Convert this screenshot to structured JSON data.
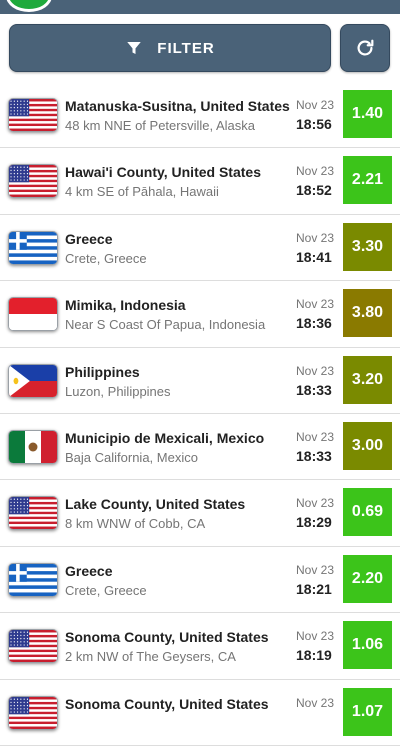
{
  "toolbar": {
    "filter_label": "FILTER",
    "filter_icon": "funnel-icon",
    "refresh_icon": "refresh-icon"
  },
  "colors": {
    "header": "#4a6278",
    "mag_low": "#3cc41a",
    "mag_mid": "#7a8a00",
    "mag_high": "#8a7a00"
  },
  "quakes": [
    {
      "place": "Matanuska-Susitna, United States",
      "detail": "48 km NNE of Petersville, Alaska",
      "date": "Nov 23",
      "time": "18:56",
      "mag": "1.40",
      "flag": "us",
      "color": "#3cc41a"
    },
    {
      "place": "Hawai'i County, United States",
      "detail": "4 km SE of Pāhala, Hawaii",
      "date": "Nov 23",
      "time": "18:52",
      "mag": "2.21",
      "flag": "us",
      "color": "#3cc41a"
    },
    {
      "place": "Greece",
      "detail": "Crete, Greece",
      "date": "Nov 23",
      "time": "18:41",
      "mag": "3.30",
      "flag": "gr",
      "color": "#7a8a00"
    },
    {
      "place": "Mimika, Indonesia",
      "detail": "Near S Coast Of Papua, Indonesia",
      "date": "Nov 23",
      "time": "18:36",
      "mag": "3.80",
      "flag": "id",
      "color": "#8a7a00"
    },
    {
      "place": "Philippines",
      "detail": "Luzon, Philippines",
      "date": "Nov 23",
      "time": "18:33",
      "mag": "3.20",
      "flag": "ph",
      "color": "#7a8a00"
    },
    {
      "place": "Municipio de Mexicali, Mexico",
      "detail": "Baja California, Mexico",
      "date": "Nov 23",
      "time": "18:33",
      "mag": "3.00",
      "flag": "mx",
      "color": "#7a8a00"
    },
    {
      "place": "Lake County, United States",
      "detail": "8 km WNW of Cobb, CA",
      "date": "Nov 23",
      "time": "18:29",
      "mag": "0.69",
      "flag": "us",
      "color": "#3cc41a"
    },
    {
      "place": "Greece",
      "detail": "Crete, Greece",
      "date": "Nov 23",
      "time": "18:21",
      "mag": "2.20",
      "flag": "gr",
      "color": "#3cc41a"
    },
    {
      "place": "Sonoma County, United States",
      "detail": "2 km NW of The Geysers, CA",
      "date": "Nov 23",
      "time": "18:19",
      "mag": "1.06",
      "flag": "us",
      "color": "#3cc41a"
    },
    {
      "place": "Sonoma County, United States",
      "detail": "",
      "date": "Nov 23",
      "time": "",
      "mag": "1.07",
      "flag": "us",
      "color": "#3cc41a"
    }
  ]
}
